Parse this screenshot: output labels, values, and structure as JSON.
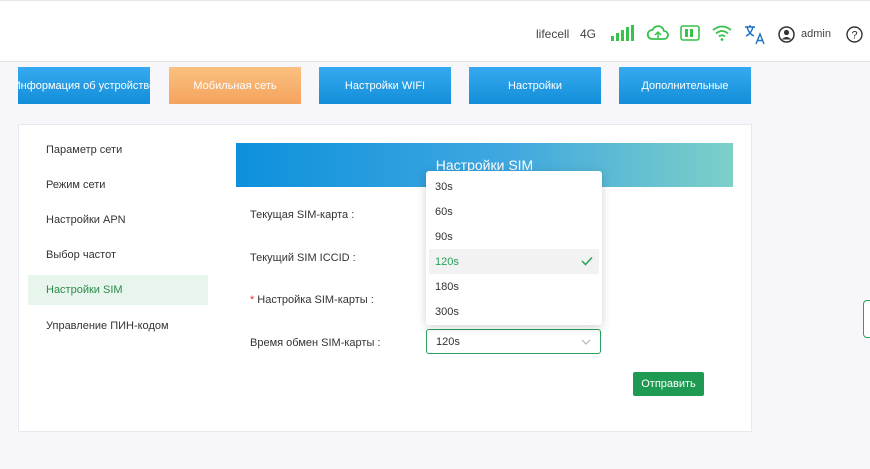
{
  "header": {
    "operator": "lifecell",
    "network_type": "4G",
    "user": "admin",
    "icons": [
      "signal-icon",
      "cloud-sync-icon",
      "sim-icon",
      "wifi-icon",
      "language-icon",
      "user-icon",
      "help-icon"
    ],
    "accent_color": "#37c24a"
  },
  "nav": {
    "device_info": "Информация об устройстве",
    "mobile_network": "Мобильная сеть",
    "wifi_settings": "Настройки WIFI",
    "settings": "Настройки",
    "advanced": "Дополнительные",
    "active": "mobile_network"
  },
  "sidebar": {
    "items": [
      {
        "label": "Параметр сети"
      },
      {
        "label": "Режим сети"
      },
      {
        "label": "Настройки APN"
      },
      {
        "label": "Выбор частот"
      },
      {
        "label": "Настройки SIM"
      },
      {
        "label": "Управление ПИН-кодом"
      }
    ],
    "active_index": 4
  },
  "main": {
    "title": "Настройки SIM",
    "current_sim_label": "Текущая SIM-карта :",
    "iccid_label": "Текущий SIM ICCID :",
    "sim_setting_required_mark": "*",
    "sim_setting_label": "Настройка SIM-карты :",
    "switch_time_label": "Время обмен SIM-карты :",
    "switch_time_value": "120s",
    "submit_label": "Отправить"
  },
  "dropdown": {
    "options": [
      "30s",
      "60s",
      "90s",
      "120s",
      "180s",
      "300s"
    ],
    "selected_index": 3
  },
  "colors": {
    "primary_green": "#1f9a52",
    "nav_blue": "#1a93de",
    "nav_orange": "#f6ac68"
  }
}
